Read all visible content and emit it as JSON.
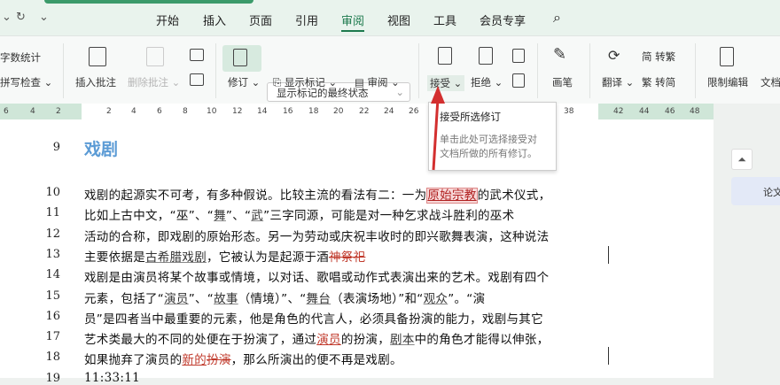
{
  "quick_access": {
    "redo": "↻",
    "more": "⌄"
  },
  "tabs": [
    "开始",
    "插入",
    "页面",
    "引用",
    "审阅",
    "视图",
    "工具",
    "会员专享"
  ],
  "active_tab": "审阅",
  "ribbon": {
    "word_count": "字数统计",
    "spell_check": "拼写检查",
    "insert_comment": "插入批注",
    "delete_comment": "删除批注",
    "track_changes": "修订",
    "markup_select": "显示标记的最终状态",
    "show_markup": "显示标记",
    "review_pane": "审阅",
    "accept": "接受",
    "reject": "拒绝",
    "pen": "画笔",
    "translate": "翻译",
    "to_traditional": "转繁",
    "to_simplified": "转简",
    "restrict_edit": "限制编辑",
    "doc": "文档"
  },
  "ruler": {
    "left": [
      "6",
      "4",
      "2"
    ],
    "right": [
      "2",
      "4",
      "6",
      "8",
      "10",
      "12",
      "14",
      "16",
      "18",
      "20",
      "22",
      "24",
      "26",
      "38"
    ],
    "tail": [
      "42",
      "44",
      "46",
      "48"
    ]
  },
  "tooltip": {
    "title": "接受所选修订",
    "desc": "单击此处可选择接受对文档所做的所有修订。"
  },
  "side_panel": {
    "label": "论文"
  },
  "document": {
    "heading_num": "9",
    "heading": "戏剧",
    "lines": [
      {
        "n": "10",
        "segs": [
          [
            "戏剧的起源实不可考，有多种假说。比较主流的看法有二：一为",
            ""
          ],
          [
            "原始宗教",
            "box"
          ],
          [
            "的武术仪式，",
            ""
          ]
        ]
      },
      {
        "n": "11",
        "segs": [
          [
            "比如上古中文，“巫”、“",
            ""
          ],
          [
            "舞",
            "u"
          ],
          [
            "”、“",
            ""
          ],
          [
            "武",
            "u"
          ],
          [
            "”三字同源，可能是对一种乞求战斗胜利的巫术",
            ""
          ]
        ]
      },
      {
        "n": "12",
        "segs": [
          [
            "活动的合称，即戏剧的原始形态。另一为劳动或庆祝丰收时的即兴歌舞表演，这种说法",
            ""
          ]
        ]
      },
      {
        "n": "13",
        "segs": [
          [
            "主要依据是",
            ""
          ],
          [
            "古希腊戏剧",
            "u"
          ],
          [
            "，它被认为是起源于酒",
            ""
          ],
          [
            "神祭祀",
            "s"
          ]
        ]
      },
      {
        "n": "14",
        "segs": [
          [
            "戏剧是由演员将某个故事或情境，以对话、歌唱或动作式表演出来的艺术。戏剧有四个",
            ""
          ]
        ]
      },
      {
        "n": "15",
        "segs": [
          [
            "元素，包括了“",
            ""
          ],
          [
            "演员",
            "u"
          ],
          [
            "”、“",
            ""
          ],
          [
            "故事",
            "u"
          ],
          [
            "（情境）”、“",
            ""
          ],
          [
            "舞台",
            "u"
          ],
          [
            "（表演场地）”和“",
            ""
          ],
          [
            "观众",
            "u"
          ],
          [
            "”。“演",
            ""
          ]
        ]
      },
      {
        "n": "16",
        "segs": [
          [
            "员”是四者当中最重要的元素，他是角色的代言人，必须具备扮演的能力，戏剧与其它",
            ""
          ]
        ]
      },
      {
        "n": "17",
        "segs": [
          [
            "艺术类最大的不同的处便在于扮演了，通过",
            ""
          ],
          [
            "演员",
            "r"
          ],
          [
            "的扮演，",
            ""
          ],
          [
            "剧本",
            "u"
          ],
          [
            "中的角色才能得以伸张，",
            ""
          ]
        ]
      },
      {
        "n": "18",
        "segs": [
          [
            "如果抛弃了演员的",
            ""
          ],
          [
            "新的",
            "r"
          ],
          [
            "扮演",
            "s"
          ],
          [
            "，那么所演出的便不再是戏剧。",
            ""
          ]
        ]
      },
      {
        "n": "19",
        "segs": [
          [
            "11:33:11",
            ""
          ]
        ]
      }
    ]
  }
}
